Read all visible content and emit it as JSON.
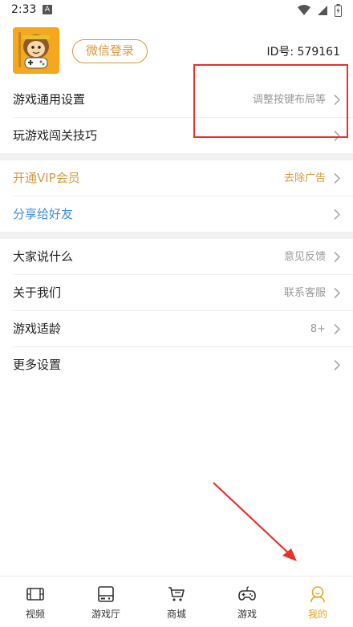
{
  "status_bar": {
    "time": "2:33",
    "notification_letter": "A"
  },
  "profile": {
    "login_button": "微信登录",
    "id_label": "ID号: ",
    "id_value": "579161"
  },
  "menu_groups": [
    {
      "items": [
        {
          "label": "游戏通用设置",
          "value": "调整按键布局等"
        },
        {
          "label": "玩游戏闯关技巧",
          "value": ""
        }
      ]
    },
    {
      "items": [
        {
          "label": "开通VIP会员",
          "value": "去除广告",
          "label_color": "#d79a3c",
          "value_color": "#d79a3c"
        },
        {
          "label": "分享给好友",
          "value": "",
          "label_color": "#3b8ee0"
        }
      ]
    },
    {
      "items": [
        {
          "label": "大家说什么",
          "value": "意见反馈"
        },
        {
          "label": "关于我们",
          "value": "联系客服"
        },
        {
          "label": "游戏适龄",
          "value": "8+"
        },
        {
          "label": "更多设置",
          "value": ""
        }
      ]
    }
  ],
  "tabs": [
    {
      "label": "视频",
      "icon": "video-icon"
    },
    {
      "label": "游戏厅",
      "icon": "arcade-icon"
    },
    {
      "label": "商城",
      "icon": "cart-icon"
    },
    {
      "label": "游戏",
      "icon": "gamepad-icon"
    },
    {
      "label": "我的",
      "icon": "profile-icon",
      "active": true
    }
  ],
  "colors": {
    "accent": "#f0a21c",
    "vip": "#d79a3c",
    "share": "#3b8ee0",
    "annotation": "#e8322b"
  }
}
